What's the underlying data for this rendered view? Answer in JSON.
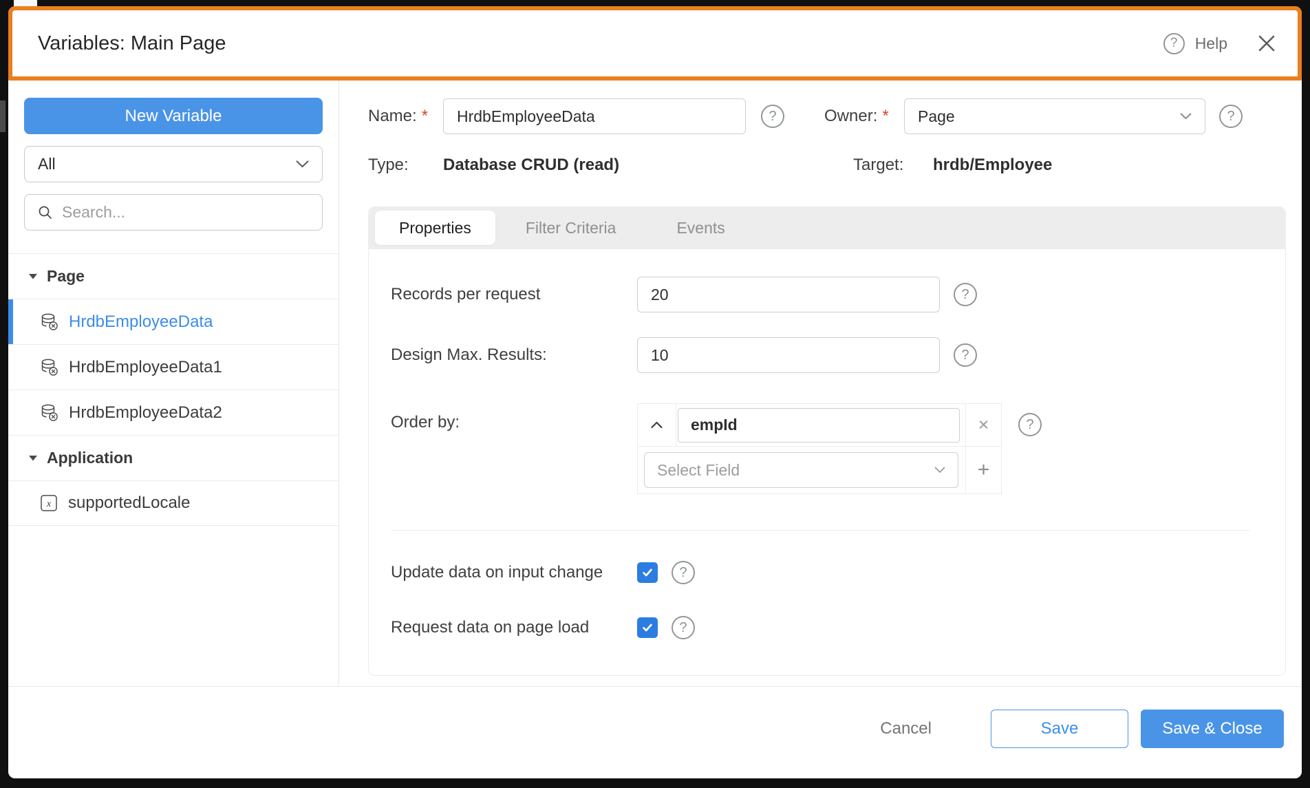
{
  "header": {
    "title": "Variables: Main Page",
    "help_label": "Help"
  },
  "sidebar": {
    "new_variable_label": "New Variable",
    "filter_value": "All",
    "search_placeholder": "Search...",
    "groups": {
      "page_label": "Page",
      "application_label": "Application"
    },
    "items": [
      {
        "label": "HrdbEmployeeData",
        "icon": "database-icon",
        "selected": true
      },
      {
        "label": "HrdbEmployeeData1",
        "icon": "database-icon",
        "selected": false
      },
      {
        "label": "HrdbEmployeeData2",
        "icon": "database-icon",
        "selected": false
      },
      {
        "label": "supportedLocale",
        "icon": "variable-icon",
        "selected": false
      }
    ]
  },
  "form": {
    "name_label": "Name:",
    "required_marker": "*",
    "name_value": "HrdbEmployeeData",
    "owner_label": "Owner:",
    "owner_value": "Page",
    "type_label": "Type:",
    "type_value": "Database CRUD (read)",
    "target_label": "Target:",
    "target_value": "hrdb/Employee"
  },
  "tabs": {
    "properties": "Properties",
    "filter_criteria": "Filter Criteria",
    "events": "Events"
  },
  "properties_panel": {
    "records_label": "Records per request",
    "records_value": "20",
    "max_results_label": "Design Max. Results:",
    "max_results_value": "10",
    "order_by_label": "Order by:",
    "order_field_value": "empId",
    "order_direction": "ascending",
    "select_field_placeholder": "Select Field",
    "remove_symbol": "×",
    "add_symbol": "+",
    "update_on_input_label": "Update data on input change",
    "update_on_input_checked": true,
    "request_on_load_label": "Request data on page load",
    "request_on_load_checked": true,
    "help_symbol": "?"
  },
  "footer": {
    "cancel_label": "Cancel",
    "save_label": "Save",
    "save_close_label": "Save & Close"
  },
  "colors": {
    "accent_blue": "#4a94e8",
    "checkbox_blue": "#2b7de1",
    "selected_item_blue": "#3d8ce8",
    "highlight_orange": "#ea7f1f"
  }
}
